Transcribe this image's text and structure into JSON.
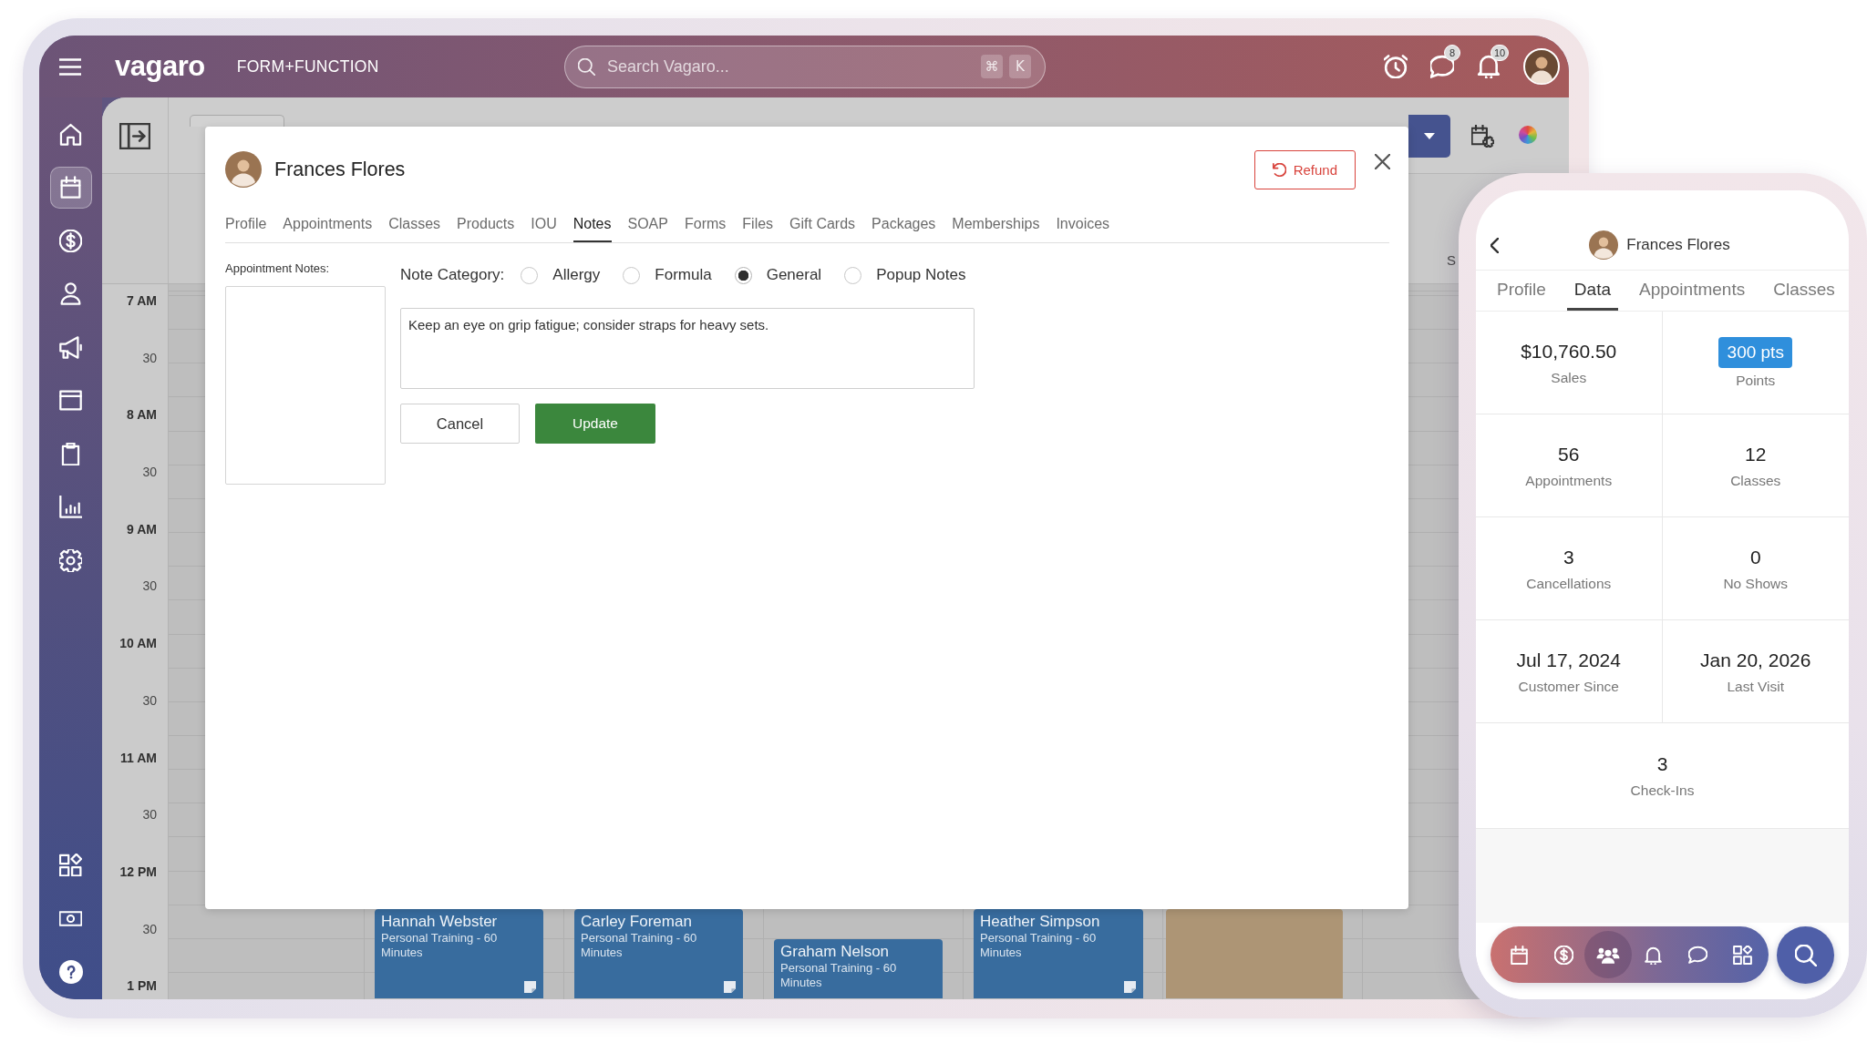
{
  "top_bar": {
    "logo": "vagaro",
    "workspace": "FORM+FUNCTION",
    "search": {
      "placeholder": "Search Vagaro...",
      "shortcut_keys": [
        "⌘",
        "K"
      ]
    },
    "messages_badge": "8",
    "notifications_badge": "10"
  },
  "sidebar": {
    "items": [
      {
        "selected": false
      },
      {
        "selected": true
      },
      {
        "selected": false
      },
      {
        "selected": false
      },
      {
        "selected": false
      },
      {
        "selected": false
      },
      {
        "selected": false
      },
      {
        "selected": false
      },
      {
        "selected": false
      }
    ]
  },
  "calendar": {
    "column_header": "S",
    "time_labels": [
      {
        "label": "7 AM",
        "kind": "hour"
      },
      {
        "label": "30",
        "kind": "half"
      },
      {
        "label": "8 AM",
        "kind": "hour"
      },
      {
        "label": "30",
        "kind": "half"
      },
      {
        "label": "9 AM",
        "kind": "hour"
      },
      {
        "label": "30",
        "kind": "half"
      },
      {
        "label": "10 AM",
        "kind": "hour"
      },
      {
        "label": "30",
        "kind": "half"
      },
      {
        "label": "11 AM",
        "kind": "hour"
      },
      {
        "label": "30",
        "kind": "half"
      },
      {
        "label": "12 PM",
        "kind": "hour"
      },
      {
        "label": "30",
        "kind": "half"
      },
      {
        "label": "1 PM",
        "kind": "hour"
      }
    ],
    "appointments": [
      {
        "kind": "appointment",
        "client": "Hannah Webster",
        "service": "Personal Training - 60 Minutes",
        "has_note": true,
        "color": "#386c9e"
      },
      {
        "kind": "appointment",
        "client": "Carley Foreman",
        "service": "Personal Training - 60 Minutes",
        "has_note": true,
        "color": "#386c9e"
      },
      {
        "kind": "appointment",
        "client": "Graham Nelson",
        "service": "Personal Training - 60 Minutes",
        "has_note": false,
        "color": "#386c9e"
      },
      {
        "kind": "appointment",
        "client": "Heather Simpson",
        "service": "Personal Training - 60 Minutes",
        "has_note": true,
        "color": "#386c9e"
      },
      {
        "kind": "blocked",
        "color": "#ad9575"
      }
    ]
  },
  "client_modal": {
    "client_name": "Frances Flores",
    "refund_button": "Refund",
    "tabs": [
      {
        "label": "Profile",
        "selected": false
      },
      {
        "label": "Appointments",
        "selected": false
      },
      {
        "label": "Classes",
        "selected": false
      },
      {
        "label": "Products",
        "selected": false
      },
      {
        "label": "IOU",
        "selected": false
      },
      {
        "label": "Notes",
        "selected": true
      },
      {
        "label": "SOAP",
        "selected": false
      },
      {
        "label": "Forms",
        "selected": false
      },
      {
        "label": "Files",
        "selected": false
      },
      {
        "label": "Gift Cards",
        "selected": false
      },
      {
        "label": "Packages",
        "selected": false
      },
      {
        "label": "Memberships",
        "selected": false
      },
      {
        "label": "Invoices",
        "selected": false
      }
    ],
    "appointment_notes_label": "Appointment Notes:",
    "note_category_label": "Note Category:",
    "note_categories": [
      {
        "label": "Allergy",
        "selected": false
      },
      {
        "label": "Formula",
        "selected": false
      },
      {
        "label": "General",
        "selected": true
      },
      {
        "label": "Popup Notes",
        "selected": false
      }
    ],
    "note_text": "Keep an eye on grip fatigue; consider straps for heavy sets.",
    "actions": [
      {
        "label": "Cancel",
        "kind": "secondary"
      },
      {
        "label": "Update",
        "kind": "primary"
      }
    ]
  },
  "mobile_client": {
    "client_name": "Frances Flores",
    "tabs": [
      {
        "label": "Profile",
        "selected": false
      },
      {
        "label": "Data",
        "selected": true
      },
      {
        "label": "Appointments",
        "selected": false
      },
      {
        "label": "Classes",
        "selected": false
      }
    ],
    "stats": [
      {
        "kind": "plain",
        "value": "$10,760.50",
        "label": "Sales"
      },
      {
        "kind": "badge",
        "value": "300 pts",
        "label": "Points"
      },
      {
        "kind": "plain",
        "value": "56",
        "label": "Appointments"
      },
      {
        "kind": "plain",
        "value": "12",
        "label": "Classes"
      },
      {
        "kind": "plain",
        "value": "3",
        "label": "Cancellations"
      },
      {
        "kind": "plain",
        "value": "0",
        "label": "No Shows"
      },
      {
        "kind": "plain",
        "value": "Jul 17, 2024",
        "label": "Customer Since"
      },
      {
        "kind": "plain",
        "value": "Jan 20, 2026",
        "label": "Last Visit"
      },
      {
        "kind": "plain",
        "value": "3",
        "label": "Check-Ins"
      }
    ],
    "bottom_nav": [
      {
        "selected": false
      },
      {
        "selected": false
      },
      {
        "selected": true
      },
      {
        "selected": false
      },
      {
        "selected": false
      },
      {
        "selected": false
      }
    ]
  }
}
